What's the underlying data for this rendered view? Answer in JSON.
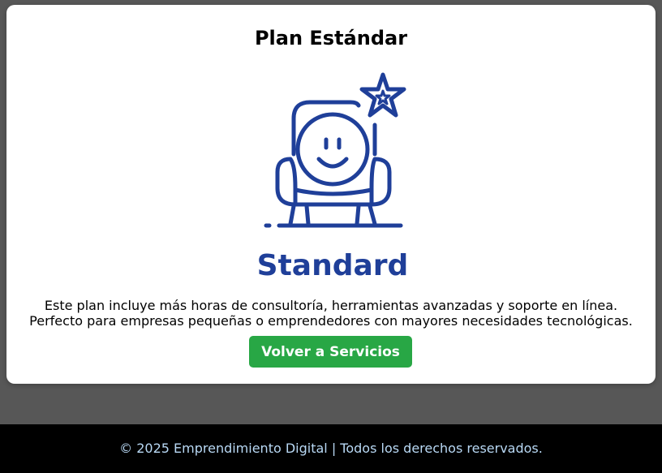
{
  "card": {
    "title": "Plan Estándar",
    "image": {
      "icon": "smiling-armchair-with-star-icon",
      "label": "Standard",
      "color": "#1f3f99"
    },
    "description_line1": "Este plan incluye más horas de consultoría, herramientas avanzadas y soporte en línea.",
    "description_line2": "Perfecto para empresas pequeñas o emprendedores con mayores necesidades tecnológicas.",
    "button_label": "Volver a Servicios"
  },
  "footer": {
    "text": "© 2025 Emprendimiento Digital | Todos los derechos reservados."
  },
  "colors": {
    "background": "#575757",
    "card": "#ffffff",
    "button": "#28a745",
    "footer": "#000000",
    "footer_text": "#b8d8f4"
  }
}
